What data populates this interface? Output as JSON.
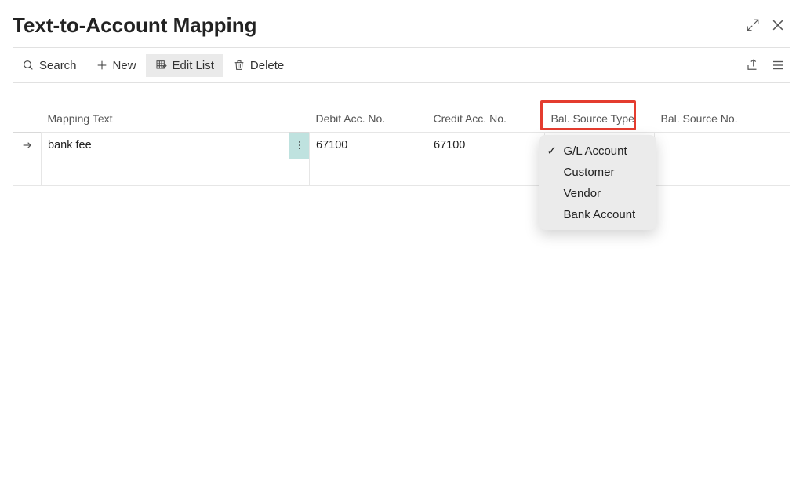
{
  "title": "Text-to-Account Mapping",
  "toolbar": {
    "search": "Search",
    "new": "New",
    "edit_list": "Edit List",
    "delete": "Delete"
  },
  "columns": {
    "mapping_text": "Mapping Text",
    "debit_acc": "Debit Acc. No.",
    "credit_acc": "Credit Acc. No.",
    "bal_source_type": "Bal. Source Type",
    "bal_source_no": "Bal. Source No."
  },
  "rows": [
    {
      "mapping_text": "bank fee",
      "debit_acc": "67100",
      "credit_acc": "67100",
      "bal_source_type": "",
      "bal_source_no": ""
    },
    {
      "mapping_text": "",
      "debit_acc": "",
      "credit_acc": "",
      "bal_source_type": "",
      "bal_source_no": ""
    }
  ],
  "dropdown": {
    "selected": "G/L Account",
    "options": [
      "G/L Account",
      "Customer",
      "Vendor",
      "Bank Account"
    ]
  }
}
